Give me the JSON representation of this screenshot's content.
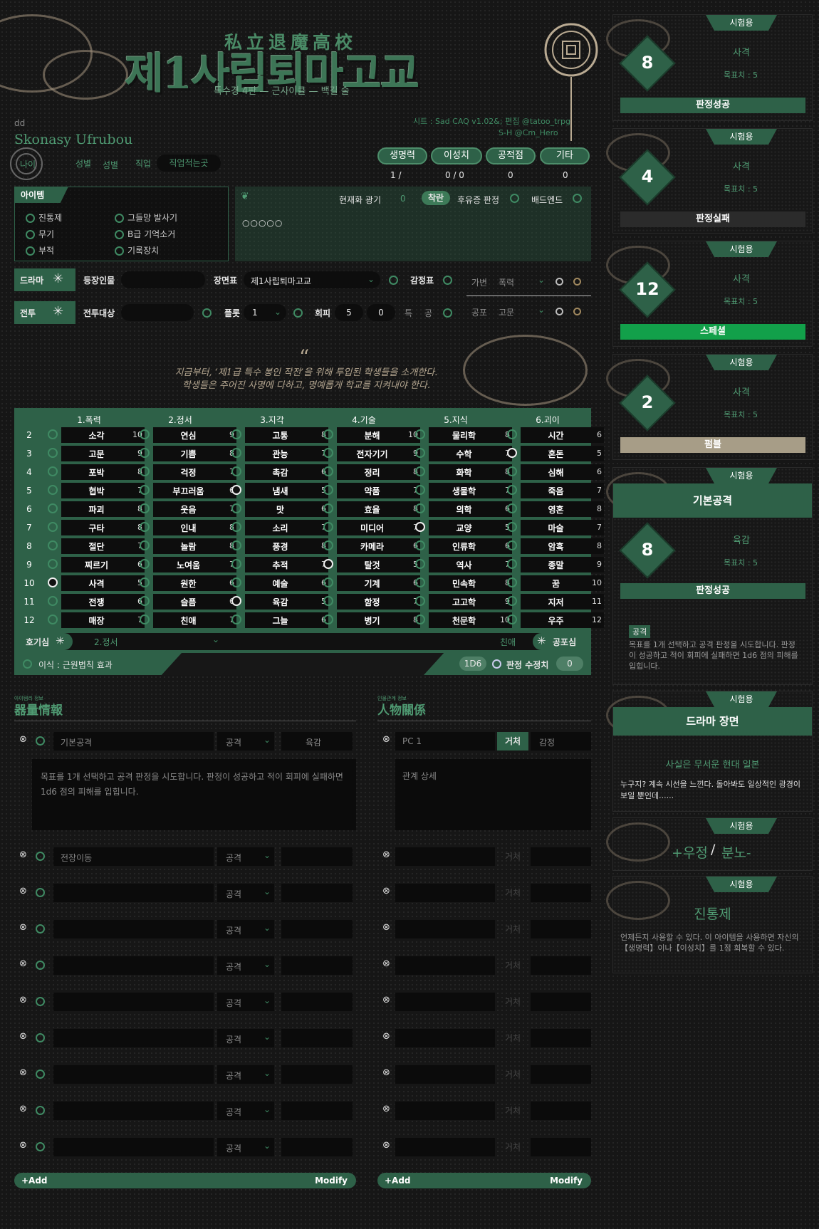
{
  "header": {
    "hanja": "私立退魔高校",
    "title": "제1사립퇴마고교",
    "subtitle": "특수경 4판 — 근사이클 — 백길 술",
    "credits_line1": "시트 : Sad CAQ v1.02&; 편집 @tatoo_trpg",
    "credits_line2": "S-H @Cm_Hero"
  },
  "character": {
    "code": "dd",
    "name": "Skonasy Ufrubou",
    "age_label": "나이",
    "gender_label": "성별",
    "gender_value": "성별",
    "job_label": "직업",
    "job_value": "직업적는곳"
  },
  "stats": [
    {
      "label": "생명력",
      "value": "1 /"
    },
    {
      "label": "이성치",
      "value": "0 / 0"
    },
    {
      "label": "공적점",
      "value": "0"
    },
    {
      "label": "기타",
      "value": "0"
    }
  ],
  "items": {
    "tag": "아이템",
    "list": [
      "진통제",
      "그들망 발사기",
      "무기",
      "B급 기억소거",
      "부적",
      "기록장치"
    ]
  },
  "madness": {
    "label": "현재화 광기",
    "value": "0",
    "chakran_label": "착란",
    "aftereffect_label": "후유증 판정",
    "badend_label": "배드엔드",
    "dots": "○○○○○"
  },
  "drama": {
    "tag": "드라마",
    "npc_label": "등장인물",
    "scene_label": "장면표",
    "scene_value": "제1사립퇴마고교",
    "emotion_label": "감정표",
    "select1": "가변",
    "select2": "폭력"
  },
  "combat": {
    "tag": "전투",
    "target_label": "전투대상",
    "plot_label": "플롯",
    "plot_value": "1",
    "evade_label": "회피",
    "evade_value": "5",
    "evade_value2": "0",
    "special_label": "특",
    "attack_label": "공",
    "select1": "공포",
    "select2": "고문"
  },
  "intro": {
    "quote_mark": "“",
    "line1": "지금부터, ‘제1급 특수 봉인 작전’을 위해 투입된 학생들을 소개한다.",
    "line2": "학생들은 주어진 사명에 다하고, 명예롭게 학교를 지켜내야 한다."
  },
  "skills": {
    "columns": [
      "1.폭력",
      "2.정서",
      "3.지각",
      "4.기술",
      "5.지식",
      "6.괴이"
    ],
    "row_numbers": [
      "2",
      "3",
      "4",
      "5",
      "6",
      "7",
      "8",
      "9",
      "10",
      "11",
      "12"
    ],
    "cells": [
      [
        [
          "소각",
          "10",
          0
        ],
        [
          "고문",
          "9",
          0
        ],
        [
          "포박",
          "8",
          0
        ],
        [
          "협박",
          "7",
          0
        ],
        [
          "파괴",
          "8",
          0
        ],
        [
          "구타",
          "8",
          0
        ],
        [
          "절단",
          "7",
          0
        ],
        [
          "찌르기",
          "6",
          0
        ],
        [
          "사격",
          "5",
          1
        ],
        [
          "전쟁",
          "6",
          0
        ],
        [
          "매장",
          "7",
          0
        ]
      ],
      [
        [
          "연심",
          "9",
          0
        ],
        [
          "기쁨",
          "8",
          0
        ],
        [
          "걱정",
          "7",
          0
        ],
        [
          "부끄러움",
          "6",
          0
        ],
        [
          "웃음",
          "7",
          0
        ],
        [
          "인내",
          "8",
          0
        ],
        [
          "놀람",
          "8",
          0
        ],
        [
          "노여움",
          "7",
          0
        ],
        [
          "원한",
          "6",
          0
        ],
        [
          "슬픔",
          "6",
          0
        ],
        [
          "친애",
          "7",
          0
        ]
      ],
      [
        [
          "고통",
          "8",
          0
        ],
        [
          "관능",
          "7",
          0
        ],
        [
          "촉감",
          "6",
          0
        ],
        [
          "냄새",
          "5",
          1
        ],
        [
          "맛",
          "6",
          0
        ],
        [
          "소리",
          "7",
          0
        ],
        [
          "풍경",
          "8",
          0
        ],
        [
          "추적",
          "7",
          0
        ],
        [
          "예술",
          "6",
          0
        ],
        [
          "육감",
          "5",
          1
        ],
        [
          "그늘",
          "6",
          0
        ]
      ],
      [
        [
          "분해",
          "10",
          0
        ],
        [
          "전자기기",
          "9",
          0
        ],
        [
          "정리",
          "8",
          0
        ],
        [
          "약품",
          "7",
          0
        ],
        [
          "효율",
          "8",
          0
        ],
        [
          "미디어",
          "7",
          0
        ],
        [
          "카메라",
          "6",
          0
        ],
        [
          "탈것",
          "5",
          1
        ],
        [
          "기계",
          "6",
          0
        ],
        [
          "함정",
          "7",
          0
        ],
        [
          "병기",
          "8",
          0
        ]
      ],
      [
        [
          "물리학",
          "8",
          0
        ],
        [
          "수학",
          "7",
          0
        ],
        [
          "화학",
          "8",
          0
        ],
        [
          "생물학",
          "7",
          0
        ],
        [
          "의학",
          "6",
          0
        ],
        [
          "교양",
          "5",
          1
        ],
        [
          "인류학",
          "6",
          0
        ],
        [
          "역사",
          "7",
          0
        ],
        [
          "민속학",
          "8",
          0
        ],
        [
          "고고학",
          "9",
          0
        ],
        [
          "천문학",
          "10",
          0
        ]
      ],
      [
        [
          "시간",
          "6",
          0
        ],
        [
          "혼돈",
          "5",
          1
        ],
        [
          "심해",
          "6",
          0
        ],
        [
          "죽음",
          "7",
          0
        ],
        [
          "영혼",
          "8",
          0
        ],
        [
          "마술",
          "7",
          0
        ],
        [
          "암흑",
          "8",
          0
        ],
        [
          "종말",
          "9",
          0
        ],
        [
          "꿈",
          "10",
          0
        ],
        [
          "지저",
          "11",
          0
        ],
        [
          "우주",
          "12",
          0
        ]
      ]
    ],
    "curiosity_label": "호기심",
    "curiosity_value": "2.정서",
    "fear_left": "친애",
    "fear_label": "공포심",
    "species_label": "이식 : 근원법칙 효과",
    "dice": "1D6",
    "modifier_label": "판정 수정치",
    "modifier_value": "0"
  },
  "equipment": {
    "small": "아이템리 정보",
    "title": "器量情報",
    "first": {
      "name": "기본공격",
      "type": "공격",
      "skill": "육감",
      "desc": "목표를 1개 선택하고 공격 판정을 시도합니다. 판정이 성공하고 적이 회피에 실패하면 1d6 점의 피해를 입힙니다."
    },
    "rows": [
      "전장이동",
      "",
      "",
      "",
      "",
      "",
      "",
      "",
      ""
    ],
    "row_type": "공격",
    "add": "+Add",
    "modify": "Modify"
  },
  "relations": {
    "small": "인물관계 정보",
    "title": "人物關係",
    "first": {
      "name": "PC 1",
      "btn_on": "거처",
      "btn_off": "감정",
      "desc": "관계 상세"
    },
    "row_btn": "거처",
    "add": "+Add",
    "modify": "Modify"
  },
  "cards": [
    {
      "tag": "시험용",
      "num": "8",
      "skill": "사격",
      "target": "목표치 : 5",
      "result": "판정성공"
    },
    {
      "tag": "시험용",
      "num": "4",
      "skill": "사격",
      "target": "목표치 : 5",
      "result": "판정실패"
    },
    {
      "tag": "시험용",
      "num": "12",
      "skill": "사격",
      "target": "목표치 : 5",
      "result": "스페셜"
    },
    {
      "tag": "시험용",
      "num": "2",
      "skill": "사격",
      "target": "목표치 : 5",
      "result": "펌블"
    },
    {
      "tag": "시험용",
      "head": "기본공격",
      "num": "8",
      "skill": "육감",
      "target": "목표치 : 5",
      "result": "판정성공",
      "badge": "공격",
      "desc": "목표를 1개 선택하고 공격 판정을 시도합니다. 판정이 성공하고 적이 회피에 실패하면 1d6 점의 피해를 입힙니다."
    },
    {
      "tag": "시험용",
      "head": "드라마 장면",
      "sub": "사실은 무서운 현대 일본",
      "desc": "누구지? 계속 시선을 느낀다. 돌아봐도 일상적인 광경이 보일 뿐인데......"
    },
    {
      "tag": "시험용",
      "love": "+우정",
      "slash": "/",
      "hate": "분노-"
    },
    {
      "tag": "시험용",
      "head": "진통제",
      "desc": "언제든지 사용할 수 있다. 이 아이템을 사용하면 자신의【생명력】이나【이성치】를 1점 회복할 수 있다."
    }
  ],
  "colors": {
    "accent": "#2e6148",
    "special": "#12a04a",
    "fumble": "#a79d87",
    "fail": "#2b2b2b"
  }
}
